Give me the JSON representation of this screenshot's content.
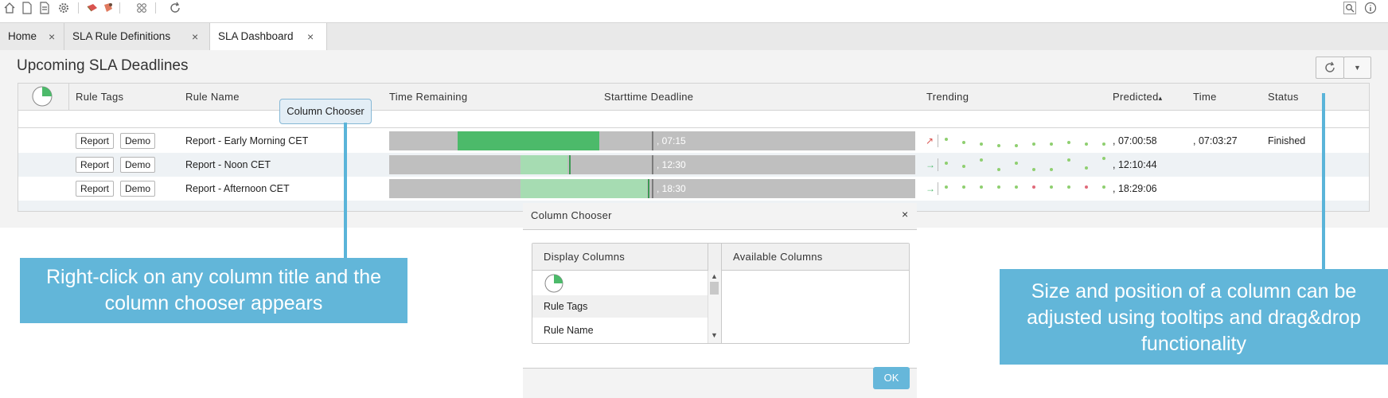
{
  "toolbar": {
    "icons": [
      "home-icon",
      "new-document-icon",
      "report-icon",
      "gear-icon",
      "tool-a-icon",
      "tool-b-icon",
      "network-icon",
      "refresh-icon"
    ],
    "right_icons": [
      "search-icon",
      "info-icon"
    ]
  },
  "tabs": [
    {
      "label": "Home",
      "close": "×"
    },
    {
      "label": "SLA Rule Definitions",
      "close": "×"
    },
    {
      "label": "SLA Dashboard",
      "close": "×"
    }
  ],
  "panel": {
    "title": "Upcoming SLA Deadlines"
  },
  "grid": {
    "headers": {
      "rule_tags": "Rule Tags",
      "rule_name": "Rule Name",
      "time_remaining": "Time Remaining",
      "starttime_deadline": "Starttime Deadline",
      "trending": "Trending",
      "predicted": "Predicted",
      "predicted_sort": "▴",
      "time": "Time",
      "status": "Status"
    },
    "rows": [
      {
        "tag1": "Report",
        "tag2": "Demo",
        "name": "Report - Early Morning CET",
        "deadline": ", 07:15",
        "predicted": ", 07:00:58",
        "time": ", 07:03:27",
        "status": "Finished",
        "trend_arrow": "↗",
        "progress": 0.27,
        "fill_color": "#4cba6a"
      },
      {
        "tag1": "Report",
        "tag2": "Demo",
        "name": "Report - Noon CET",
        "deadline": ", 12:30",
        "predicted": ", 12:10:44",
        "time": "",
        "status": "",
        "trend_arrow": "→",
        "progress": 0.09,
        "fill_color": "#a6dcb2"
      },
      {
        "tag1": "Report",
        "tag2": "Demo",
        "name": "Report - Afternoon CET",
        "deadline": ", 18:30",
        "predicted": ", 18:29:06",
        "time": "",
        "status": "",
        "trend_arrow": "→",
        "progress": 0.24,
        "fill_color": "#a6dcb2"
      }
    ]
  },
  "tooltip": {
    "text": "Column Chooser"
  },
  "dialog": {
    "title": "Column Chooser",
    "close": "×",
    "display_header": "Display Columns",
    "available_header": "Available Columns",
    "display_items": [
      "Rule Tags",
      "Rule Name"
    ],
    "ok": "OK"
  },
  "callouts": {
    "left": "Right-click on any column title and the column chooser appears",
    "right": "Size and position of a column can be adjusted using tooltips and drag&drop functionality"
  },
  "colors": {
    "accent": "#62b6d9",
    "green_dark": "#4cba6a",
    "green_light": "#a6dcb2",
    "bar_grey": "#bfbfbf"
  }
}
